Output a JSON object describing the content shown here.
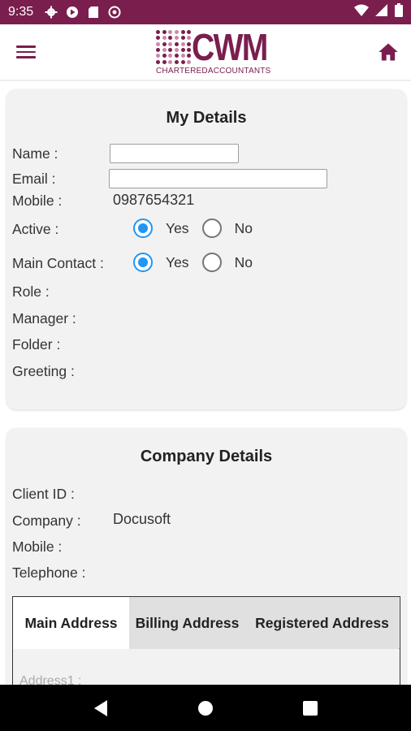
{
  "status_bar": {
    "time": "9:35",
    "left_icons": [
      "settings-icon",
      "play-protect-icon",
      "sd-card-icon",
      "sync-icon"
    ],
    "right_icons": [
      "wifi-icon",
      "signal-icon",
      "battery-icon"
    ]
  },
  "header": {
    "logo_text": "CWM",
    "logo_tagline": "CHARTEREDACCOUNTANTS",
    "brand_color": "#7a1e4e"
  },
  "my_details": {
    "title": "My Details",
    "name_label": "Name :",
    "name_value": "",
    "email_label": "Email :",
    "email_value": "",
    "mobile_label": "Mobile :",
    "mobile_value": "0987654321",
    "active_label": "Active :",
    "active_yes": "Yes",
    "active_no": "No",
    "active_selected": "Yes",
    "main_contact_label": "Main Contact :",
    "main_contact_yes": "Yes",
    "main_contact_no": "No",
    "main_contact_selected": "Yes",
    "role_label": "Role :",
    "manager_label": "Manager :",
    "folder_label": "Folder :",
    "greeting_label": "Greeting :"
  },
  "company_details": {
    "title": "Company Details",
    "client_id_label": "Client ID :",
    "company_label": "Company :",
    "company_value": "Docusoft",
    "mobile_label": "Mobile :",
    "telephone_label": "Telephone :",
    "tabs": [
      "Main Address",
      "Billing Address",
      "Registered Address"
    ],
    "active_tab": "Main Address",
    "address1_label": "Address1 :"
  },
  "colors": {
    "accent": "#2196f3",
    "card_bg": "#f2f2f2"
  }
}
